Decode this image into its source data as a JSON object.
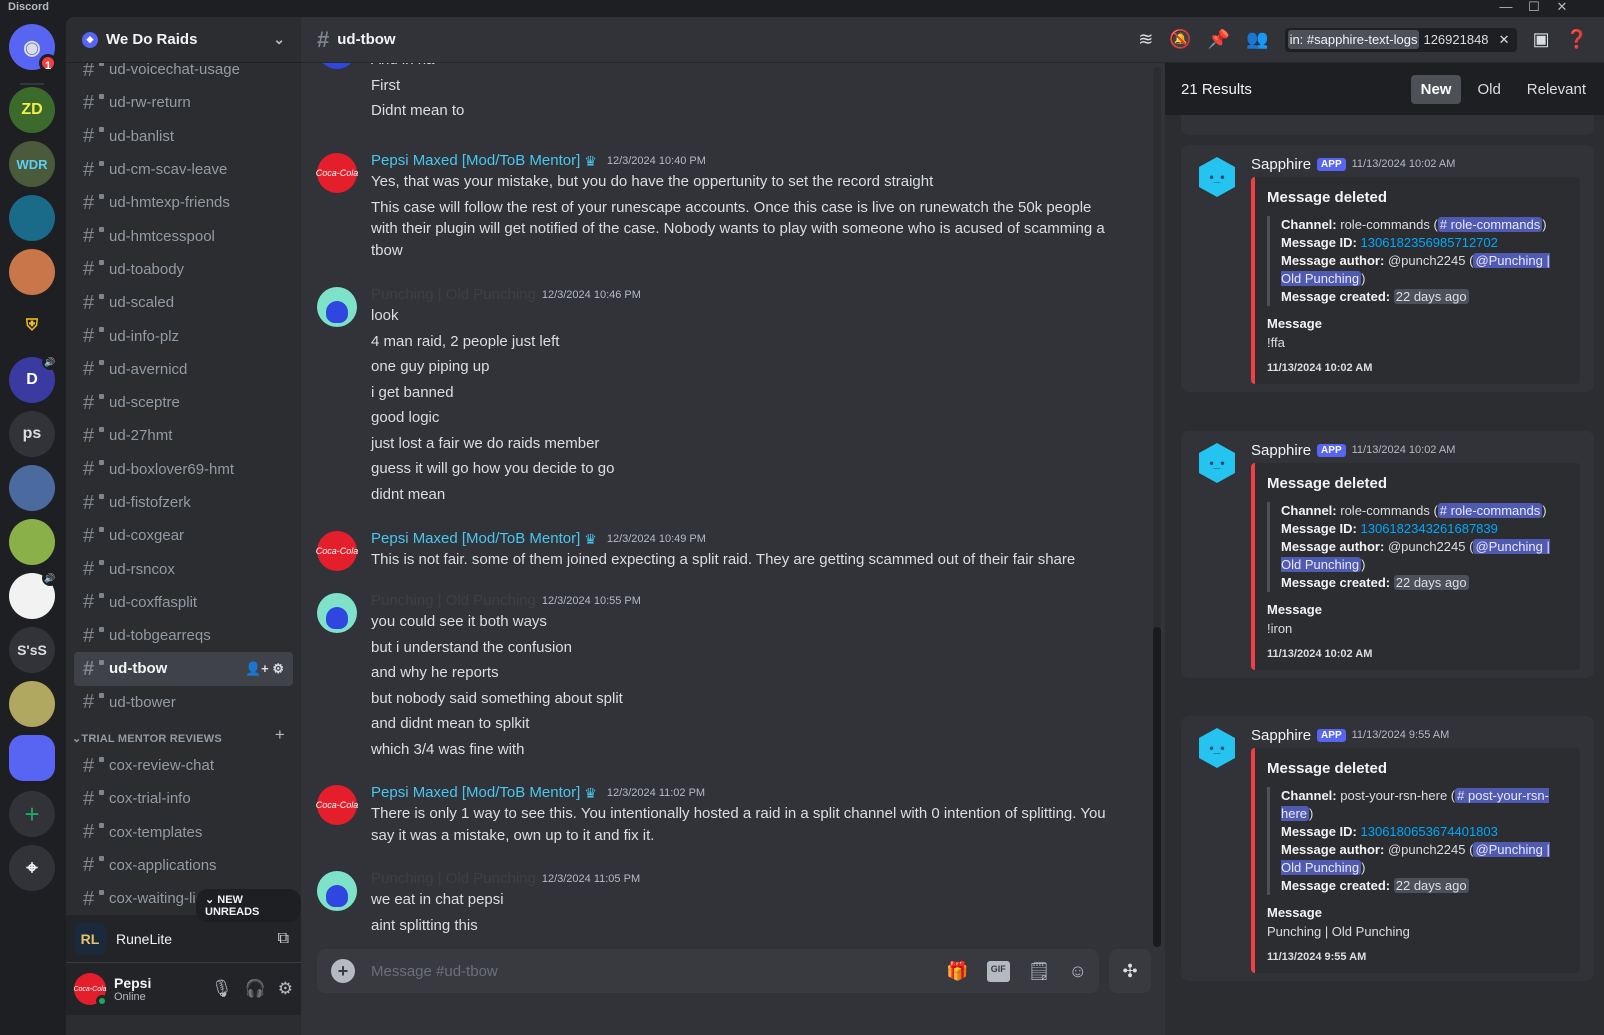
{
  "window": {
    "title": "Discord",
    "minimize": "—",
    "maximize": "☐",
    "close": "✕"
  },
  "rail": {
    "home_badge": "1",
    "servers": [
      {
        "name": "home",
        "label": ""
      },
      {
        "name": "zd",
        "label": "ZD"
      },
      {
        "name": "wdr",
        "label": "WDR"
      },
      {
        "name": "blue-monster",
        "label": ""
      },
      {
        "name": "bird",
        "label": ""
      },
      {
        "name": "spartan",
        "label": ""
      },
      {
        "name": "d-server",
        "label": "D"
      },
      {
        "name": "ps",
        "label": "ps"
      },
      {
        "name": "cat",
        "label": ""
      },
      {
        "name": "frog",
        "label": ""
      },
      {
        "name": "trollface",
        "label": ""
      },
      {
        "name": "sss",
        "label": "S'sS"
      },
      {
        "name": "trophy",
        "label": ""
      },
      {
        "name": "folder",
        "label": ""
      }
    ],
    "add_server": "+",
    "discover": "⌖"
  },
  "sidebar": {
    "guild_name": "We Do Raids",
    "channels": [
      "ud-voicechat-usage",
      "ud-rw-return",
      "ud-banlist",
      "ud-cm-scav-leave",
      "ud-hmtexp-friends",
      "ud-hmtcesspool",
      "ud-toabody",
      "ud-scaled",
      "ud-info-plz",
      "ud-avernicd",
      "ud-sceptre",
      "ud-27hmt",
      "ud-boxlover69-hmt",
      "ud-fistofzerk",
      "ud-coxgear",
      "ud-rsncox",
      "ud-coxffasplit",
      "ud-tobgearreqs",
      "ud-tbow",
      "ud-tbower"
    ],
    "active_channel": "ud-tbow",
    "category": "TRIAL MENTOR REVIEWS",
    "category_channels": [
      "cox-review-chat",
      "cox-trial-info",
      "cox-templates",
      "cox-applications",
      "cox-waiting-list"
    ],
    "new_unreads": "NEW UNREADS",
    "activity": {
      "app_name": "RuneLite",
      "app_icon": "RL"
    },
    "user": {
      "name": "Pepsi",
      "status": "Online"
    }
  },
  "header": {
    "channel": "ud-tbow",
    "search_filter": "in: #sapphire-text-logs",
    "search_query": "126921848"
  },
  "messages": [
    {
      "author": "",
      "ts": "",
      "lines": [
        "And in ha",
        "First",
        "Didnt mean to"
      ]
    },
    {
      "author": "Pepsi Maxed [Mod/ToB Mentor]",
      "ts": "12/3/2024 10:40 PM",
      "lines": [
        "Yes, that was your mistake, but you do have the oppertunity to set the record straight",
        "This case will follow the rest of your runescape accounts. Once this case is live on runewatch the 50k people with their plugin will get notified of the case. Nobody wants to play with someone who is acused of scamming a tbow"
      ]
    },
    {
      "author": "Punching | Old Punching",
      "ts": "12/3/2024 10:46 PM",
      "lines": [
        "look",
        "4 man raid, 2 people just left",
        "one guy piping up",
        "i get banned",
        "good logic",
        "just lost a fair we do raids member",
        "guess it will go how you decide to go",
        "didnt mean"
      ]
    },
    {
      "author": "Pepsi Maxed [Mod/ToB Mentor]",
      "ts": "12/3/2024 10:49 PM",
      "lines": [
        "This is not fair. some of them joined expecting a split raid. They are getting scammed out of their fair share"
      ]
    },
    {
      "author": "Punching | Old Punching",
      "ts": "12/3/2024 10:55 PM",
      "lines": [
        "you could see it both ways",
        "but i understand the confusion",
        "and why he reports",
        "but nobody said something about split",
        "and didnt mean to splkit",
        "which 3/4 was fine with"
      ]
    },
    {
      "author": "Pepsi Maxed [Mod/ToB Mentor]",
      "ts": "12/3/2024 11:02 PM",
      "lines": [
        "There is only 1 way to see this. You intentionally hosted a raid in a split channel with 0 intention of splitting. You say it was a mistake, own up to it and fix it."
      ]
    },
    {
      "author": "Punching | Old Punching",
      "ts": "12/3/2024 11:05 PM",
      "lines": [
        "we eat in chat pepsi",
        "aint splitting this"
      ]
    }
  ],
  "composer": {
    "placeholder": "Message #ud-tbow",
    "gif": "GIF"
  },
  "results": {
    "count": "21 Results",
    "sorts": [
      "New",
      "Old",
      "Relevant"
    ],
    "active_sort": "New",
    "items": [
      {
        "author": "Sapphire",
        "tag": "APP",
        "ts": "11/13/2024 10:02 AM",
        "title": "Message deleted",
        "channel_label": "Channel:",
        "channel": "role-commands",
        "channel_mention": "# role-commands",
        "id_label": "Message ID:",
        "id": "1306182356985712702",
        "author_label": "Message author:",
        "author_handle": "@punch2245",
        "author_mention": "@Punching | Old Punching",
        "created_label": "Message created:",
        "created": "22 days ago",
        "field_name": "Message",
        "field_value": "!ffa",
        "footer": "11/13/2024 10:02 AM"
      },
      {
        "author": "Sapphire",
        "tag": "APP",
        "ts": "11/13/2024 10:02 AM",
        "title": "Message deleted",
        "channel_label": "Channel:",
        "channel": "role-commands",
        "channel_mention": "# role-commands",
        "id_label": "Message ID:",
        "id": "1306182343261687839",
        "author_label": "Message author:",
        "author_handle": "@punch2245",
        "author_mention": "@Punching | Old Punching",
        "created_label": "Message created:",
        "created": "22 days ago",
        "field_name": "Message",
        "field_value": "!iron",
        "footer": "11/13/2024 10:02 AM"
      },
      {
        "author": "Sapphire",
        "tag": "APP",
        "ts": "11/13/2024 9:55 AM",
        "title": "Message deleted",
        "channel_label": "Channel:",
        "channel": "post-your-rsn-here",
        "channel_mention": "# post-your-rsn-here",
        "id_label": "Message ID:",
        "id": "1306180653674401803",
        "author_label": "Message author:",
        "author_handle": "@punch2245",
        "author_mention": "@Punching | Old Punching",
        "created_label": "Message created:",
        "created": "22 days ago",
        "field_name": "Message",
        "field_value": "Punching | Old Punching",
        "footer": "11/13/2024 9:55 AM"
      }
    ]
  },
  "colors": {
    "accent": "#5865f2",
    "mod_name": "#48c7f0",
    "embed_bar": "#f23f43",
    "online": "#23a55a",
    "link": "#00a8fc"
  }
}
